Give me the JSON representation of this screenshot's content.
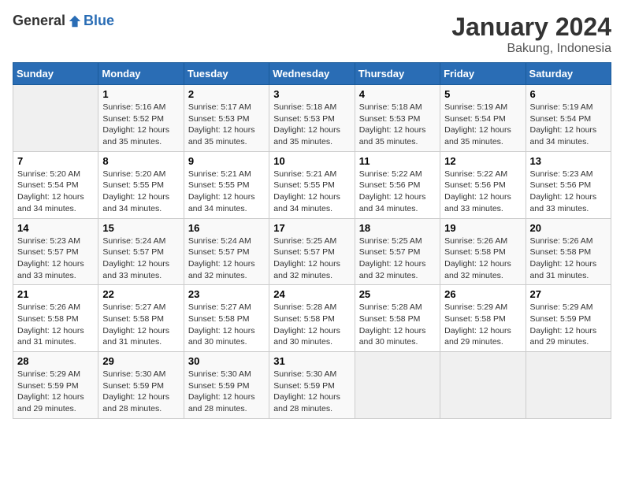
{
  "logo": {
    "general": "General",
    "blue": "Blue"
  },
  "title": "January 2024",
  "subtitle": "Bakung, Indonesia",
  "headers": [
    "Sunday",
    "Monday",
    "Tuesday",
    "Wednesday",
    "Thursday",
    "Friday",
    "Saturday"
  ],
  "weeks": [
    [
      {
        "day": "",
        "info": ""
      },
      {
        "day": "1",
        "info": "Sunrise: 5:16 AM\nSunset: 5:52 PM\nDaylight: 12 hours\nand 35 minutes."
      },
      {
        "day": "2",
        "info": "Sunrise: 5:17 AM\nSunset: 5:53 PM\nDaylight: 12 hours\nand 35 minutes."
      },
      {
        "day": "3",
        "info": "Sunrise: 5:18 AM\nSunset: 5:53 PM\nDaylight: 12 hours\nand 35 minutes."
      },
      {
        "day": "4",
        "info": "Sunrise: 5:18 AM\nSunset: 5:53 PM\nDaylight: 12 hours\nand 35 minutes."
      },
      {
        "day": "5",
        "info": "Sunrise: 5:19 AM\nSunset: 5:54 PM\nDaylight: 12 hours\nand 35 minutes."
      },
      {
        "day": "6",
        "info": "Sunrise: 5:19 AM\nSunset: 5:54 PM\nDaylight: 12 hours\nand 34 minutes."
      }
    ],
    [
      {
        "day": "7",
        "info": "Sunrise: 5:20 AM\nSunset: 5:54 PM\nDaylight: 12 hours\nand 34 minutes."
      },
      {
        "day": "8",
        "info": "Sunrise: 5:20 AM\nSunset: 5:55 PM\nDaylight: 12 hours\nand 34 minutes."
      },
      {
        "day": "9",
        "info": "Sunrise: 5:21 AM\nSunset: 5:55 PM\nDaylight: 12 hours\nand 34 minutes."
      },
      {
        "day": "10",
        "info": "Sunrise: 5:21 AM\nSunset: 5:55 PM\nDaylight: 12 hours\nand 34 minutes."
      },
      {
        "day": "11",
        "info": "Sunrise: 5:22 AM\nSunset: 5:56 PM\nDaylight: 12 hours\nand 34 minutes."
      },
      {
        "day": "12",
        "info": "Sunrise: 5:22 AM\nSunset: 5:56 PM\nDaylight: 12 hours\nand 33 minutes."
      },
      {
        "day": "13",
        "info": "Sunrise: 5:23 AM\nSunset: 5:56 PM\nDaylight: 12 hours\nand 33 minutes."
      }
    ],
    [
      {
        "day": "14",
        "info": "Sunrise: 5:23 AM\nSunset: 5:57 PM\nDaylight: 12 hours\nand 33 minutes."
      },
      {
        "day": "15",
        "info": "Sunrise: 5:24 AM\nSunset: 5:57 PM\nDaylight: 12 hours\nand 33 minutes."
      },
      {
        "day": "16",
        "info": "Sunrise: 5:24 AM\nSunset: 5:57 PM\nDaylight: 12 hours\nand 32 minutes."
      },
      {
        "day": "17",
        "info": "Sunrise: 5:25 AM\nSunset: 5:57 PM\nDaylight: 12 hours\nand 32 minutes."
      },
      {
        "day": "18",
        "info": "Sunrise: 5:25 AM\nSunset: 5:57 PM\nDaylight: 12 hours\nand 32 minutes."
      },
      {
        "day": "19",
        "info": "Sunrise: 5:26 AM\nSunset: 5:58 PM\nDaylight: 12 hours\nand 32 minutes."
      },
      {
        "day": "20",
        "info": "Sunrise: 5:26 AM\nSunset: 5:58 PM\nDaylight: 12 hours\nand 31 minutes."
      }
    ],
    [
      {
        "day": "21",
        "info": "Sunrise: 5:26 AM\nSunset: 5:58 PM\nDaylight: 12 hours\nand 31 minutes."
      },
      {
        "day": "22",
        "info": "Sunrise: 5:27 AM\nSunset: 5:58 PM\nDaylight: 12 hours\nand 31 minutes."
      },
      {
        "day": "23",
        "info": "Sunrise: 5:27 AM\nSunset: 5:58 PM\nDaylight: 12 hours\nand 30 minutes."
      },
      {
        "day": "24",
        "info": "Sunrise: 5:28 AM\nSunset: 5:58 PM\nDaylight: 12 hours\nand 30 minutes."
      },
      {
        "day": "25",
        "info": "Sunrise: 5:28 AM\nSunset: 5:58 PM\nDaylight: 12 hours\nand 30 minutes."
      },
      {
        "day": "26",
        "info": "Sunrise: 5:29 AM\nSunset: 5:58 PM\nDaylight: 12 hours\nand 29 minutes."
      },
      {
        "day": "27",
        "info": "Sunrise: 5:29 AM\nSunset: 5:59 PM\nDaylight: 12 hours\nand 29 minutes."
      }
    ],
    [
      {
        "day": "28",
        "info": "Sunrise: 5:29 AM\nSunset: 5:59 PM\nDaylight: 12 hours\nand 29 minutes."
      },
      {
        "day": "29",
        "info": "Sunrise: 5:30 AM\nSunset: 5:59 PM\nDaylight: 12 hours\nand 28 minutes."
      },
      {
        "day": "30",
        "info": "Sunrise: 5:30 AM\nSunset: 5:59 PM\nDaylight: 12 hours\nand 28 minutes."
      },
      {
        "day": "31",
        "info": "Sunrise: 5:30 AM\nSunset: 5:59 PM\nDaylight: 12 hours\nand 28 minutes."
      },
      {
        "day": "",
        "info": ""
      },
      {
        "day": "",
        "info": ""
      },
      {
        "day": "",
        "info": ""
      }
    ]
  ]
}
